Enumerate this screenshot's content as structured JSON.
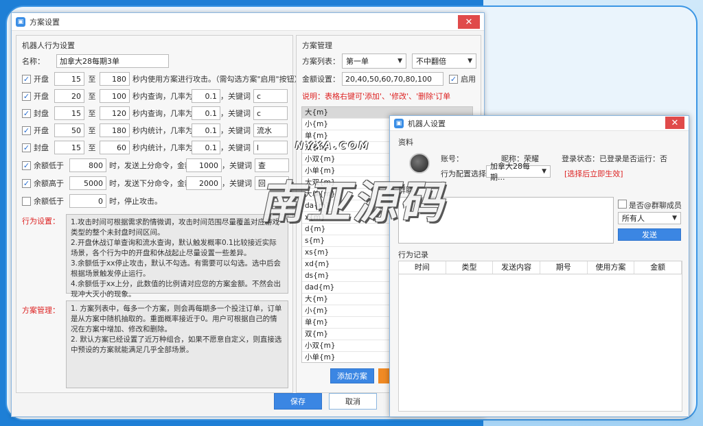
{
  "main_dialog": {
    "title": "方案设置",
    "close_glyph": "✕",
    "behavior": {
      "group_title": "机器人行为设置",
      "name_label": "名称：",
      "name_value": "加拿大28每期3单",
      "rows": [
        {
          "checked": true,
          "label": "开盘",
          "a": "15",
          "sep": "至",
          "b": "180",
          "text": "秒内使用方案进行攻击。（需勾选方案\"启用\"按钮）"
        },
        {
          "checked": true,
          "label": "开盘",
          "a": "20",
          "sep": "至",
          "b": "100",
          "text": "秒内查询，几率为",
          "rate": "0.1",
          "kw_label": "，关键词",
          "kw": "c"
        },
        {
          "checked": true,
          "label": "封盘",
          "a": "15",
          "sep": "至",
          "b": "120",
          "text": "秒内查询，几率为",
          "rate": "0.1",
          "kw_label": "，关键词",
          "kw": "c"
        },
        {
          "checked": true,
          "label": "开盘",
          "a": "50",
          "sep": "至",
          "b": "180",
          "text": "秒内统计，几率为",
          "rate": "0.1",
          "kw_label": "，关键词",
          "kw": "流水"
        },
        {
          "checked": true,
          "label": "封盘",
          "a": "15",
          "sep": "至",
          "b": "60",
          "text": "秒内统计，几率为",
          "rate": "0.1",
          "kw_label": "，关键词",
          "kw": "l"
        }
      ],
      "balance_rows": [
        {
          "checked": true,
          "label": "余额低于",
          "v": "800",
          "text": "时，发送上分命令，金额",
          "amt": "1000",
          "kw_label": "，关键词",
          "kw": "查"
        },
        {
          "checked": true,
          "label": "余额高于",
          "v": "5000",
          "text": "时，发送下分命令，金额",
          "amt": "2000",
          "kw_label": "，关键词",
          "kw": "回"
        },
        {
          "checked": false,
          "label": "余额低于",
          "v": "0",
          "text": "时，停止攻击。"
        }
      ],
      "check_glyph": "✓",
      "behavior_note_label": "行为设置：",
      "behavior_note": [
        "1.攻击时间可根据需求酌情微调，攻击时间范围尽量覆盖对应游戏类型的整个未封盘时间区间。",
        "2.开盘休战订单查询和流水查询，默认触发概率0.1比较接近实际场景，各个行为中的开盘和休战起止尽量设置一些差异。",
        "3.余额低于xx停止攻击，默认不勾选。有需要可以勾选。选中后会根据场景触发停止运行。",
        "4.余额低于xx上分，此数值的比例请对应您的方案金额。不然会出现冲大灭小的现象。"
      ],
      "plan_note_label": "方案管理：",
      "plan_note": [
        "1. 方案列表中，每多一个方案，则会再每期多一个投注订单，订单是从方案中随机抽取的。重面概率接近于0。用户可根据自己的情况在方案中增加、修改和删除。",
        "2. 默认方案已经设置了近万种组合，如果不愿意自定义，则直接选中预设的方案就能满足几乎全部场景。"
      ]
    },
    "plan": {
      "group_title": "方案管理",
      "list_label": "方案列表：",
      "list_value": "第一单",
      "multiplier_value": "不中翻倍",
      "amount_label": "金额设置：",
      "amount_value": "20,40,50,60,70,80,100",
      "enable_label": "启用",
      "note": "说明：表格右键可'添加'、'修改'、'删除'订单",
      "items": [
        "大{m}",
        "小{m}",
        "单{m}",
        "双{m}",
        "小双{m}",
        "小单{m}",
        "大双{m}",
        "大单{m}",
        "da{m}",
        "x{m}",
        "d{m}",
        "s{m}",
        "xs{m}",
        "xd{m}",
        "ds{m}",
        "dad{m}",
        "大{m}",
        "小{m}",
        "单{m}",
        "双{m}",
        "小双{m}",
        "小单{m}"
      ],
      "add_button": "添加方案"
    },
    "save_button": "保存",
    "cancel_button": "取消"
  },
  "robot_dialog": {
    "title": "机器人设置",
    "close_glyph": "✕",
    "profile_section": "资料",
    "account_label": "账号：",
    "nickname_label": "昵称：荣耀",
    "login_status": "登录状态：已登录",
    "running_status": "是否运行：否",
    "config_label": "行为配置选择：",
    "config_value": "加拿大28每期...",
    "config_note": "[选择后立即生效]",
    "group_section": "群聊",
    "at_members_label": "是否@群聊成员",
    "target_value": "所有人",
    "send_button": "发送",
    "records_section": "行为记录",
    "columns": [
      "时间",
      "类型",
      "发送内容",
      "期号",
      "使用方案",
      "金额"
    ]
  },
  "watermark": {
    "main": "南亚源码",
    "sub": "NYXA.COM"
  }
}
